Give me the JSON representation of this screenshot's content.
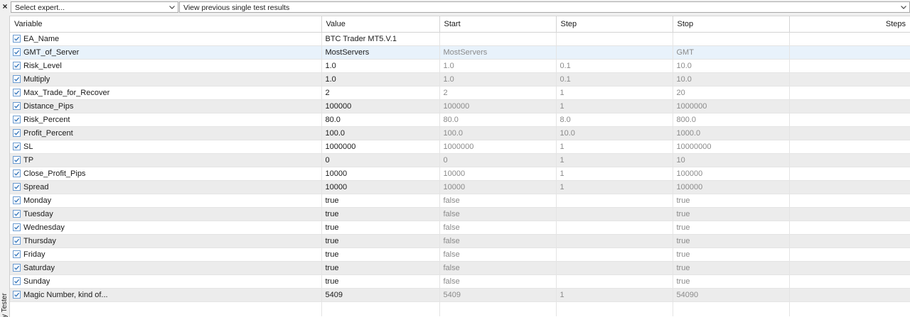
{
  "left_panel": {
    "close_glyph": "×",
    "tab_label": "y Tester"
  },
  "toolbar": {
    "expert_select": "Select expert...",
    "results_select": "View previous single test results"
  },
  "columns": [
    "Variable",
    "Value",
    "Start",
    "Step",
    "Stop",
    "Steps"
  ],
  "rows": [
    {
      "variable": "EA_Name",
      "value": "BTC Trader MT5.V.1",
      "start": "",
      "step": "",
      "stop": "",
      "steps": "",
      "checked": true
    },
    {
      "variable": "GMT_of_Server",
      "value": "MostServers",
      "start": "MostServers",
      "step": "",
      "stop": "GMT",
      "steps": "",
      "checked": true,
      "selected": true
    },
    {
      "variable": "Risk_Level",
      "value": "1.0",
      "start": "1.0",
      "step": "0.1",
      "stop": "10.0",
      "steps": "",
      "checked": true
    },
    {
      "variable": "Multiply",
      "value": "1.0",
      "start": "1.0",
      "step": "0.1",
      "stop": "10.0",
      "steps": "",
      "checked": true
    },
    {
      "variable": "Max_Trade_for_Recover",
      "value": "2",
      "start": "2",
      "step": "1",
      "stop": "20",
      "steps": "",
      "checked": true
    },
    {
      "variable": "Distance_Pips",
      "value": "100000",
      "start": "100000",
      "step": "1",
      "stop": "1000000",
      "steps": "",
      "checked": true
    },
    {
      "variable": "Risk_Percent",
      "value": "80.0",
      "start": "80.0",
      "step": "8.0",
      "stop": "800.0",
      "steps": "",
      "checked": true
    },
    {
      "variable": "Profit_Percent",
      "value": "100.0",
      "start": "100.0",
      "step": "10.0",
      "stop": "1000.0",
      "steps": "",
      "checked": true
    },
    {
      "variable": "SL",
      "value": "1000000",
      "start": "1000000",
      "step": "1",
      "stop": "10000000",
      "steps": "",
      "checked": true
    },
    {
      "variable": "TP",
      "value": "0",
      "start": "0",
      "step": "1",
      "stop": "10",
      "steps": "",
      "checked": true
    },
    {
      "variable": "Close_Profit_Pips",
      "value": "10000",
      "start": "10000",
      "step": "1",
      "stop": "100000",
      "steps": "",
      "checked": true
    },
    {
      "variable": "Spread",
      "value": "10000",
      "start": "10000",
      "step": "1",
      "stop": "100000",
      "steps": "",
      "checked": true
    },
    {
      "variable": "Monday",
      "value": "true",
      "start": "false",
      "step": "",
      "stop": "true",
      "steps": "",
      "checked": true
    },
    {
      "variable": "Tuesday",
      "value": "true",
      "start": "false",
      "step": "",
      "stop": "true",
      "steps": "",
      "checked": true
    },
    {
      "variable": "Wednesday",
      "value": "true",
      "start": "false",
      "step": "",
      "stop": "true",
      "steps": "",
      "checked": true
    },
    {
      "variable": "Thursday",
      "value": "true",
      "start": "false",
      "step": "",
      "stop": "true",
      "steps": "",
      "checked": true
    },
    {
      "variable": "Friday",
      "value": "true",
      "start": "false",
      "step": "",
      "stop": "true",
      "steps": "",
      "checked": true
    },
    {
      "variable": "Saturday",
      "value": "true",
      "start": "false",
      "step": "",
      "stop": "true",
      "steps": "",
      "checked": true
    },
    {
      "variable": "Sunday",
      "value": "true",
      "start": "false",
      "step": "",
      "stop": "true",
      "steps": "",
      "checked": true
    },
    {
      "variable": "Magic Number, kind of...",
      "value": "5409",
      "start": "5409",
      "step": "1",
      "stop": "54090",
      "steps": "",
      "checked": true
    }
  ],
  "colors": {
    "selected_row": "#e8f2fb",
    "alt_row": "#ececec",
    "checkbox_border": "#6a9bd1",
    "muted_text": "#8a8a8a"
  }
}
